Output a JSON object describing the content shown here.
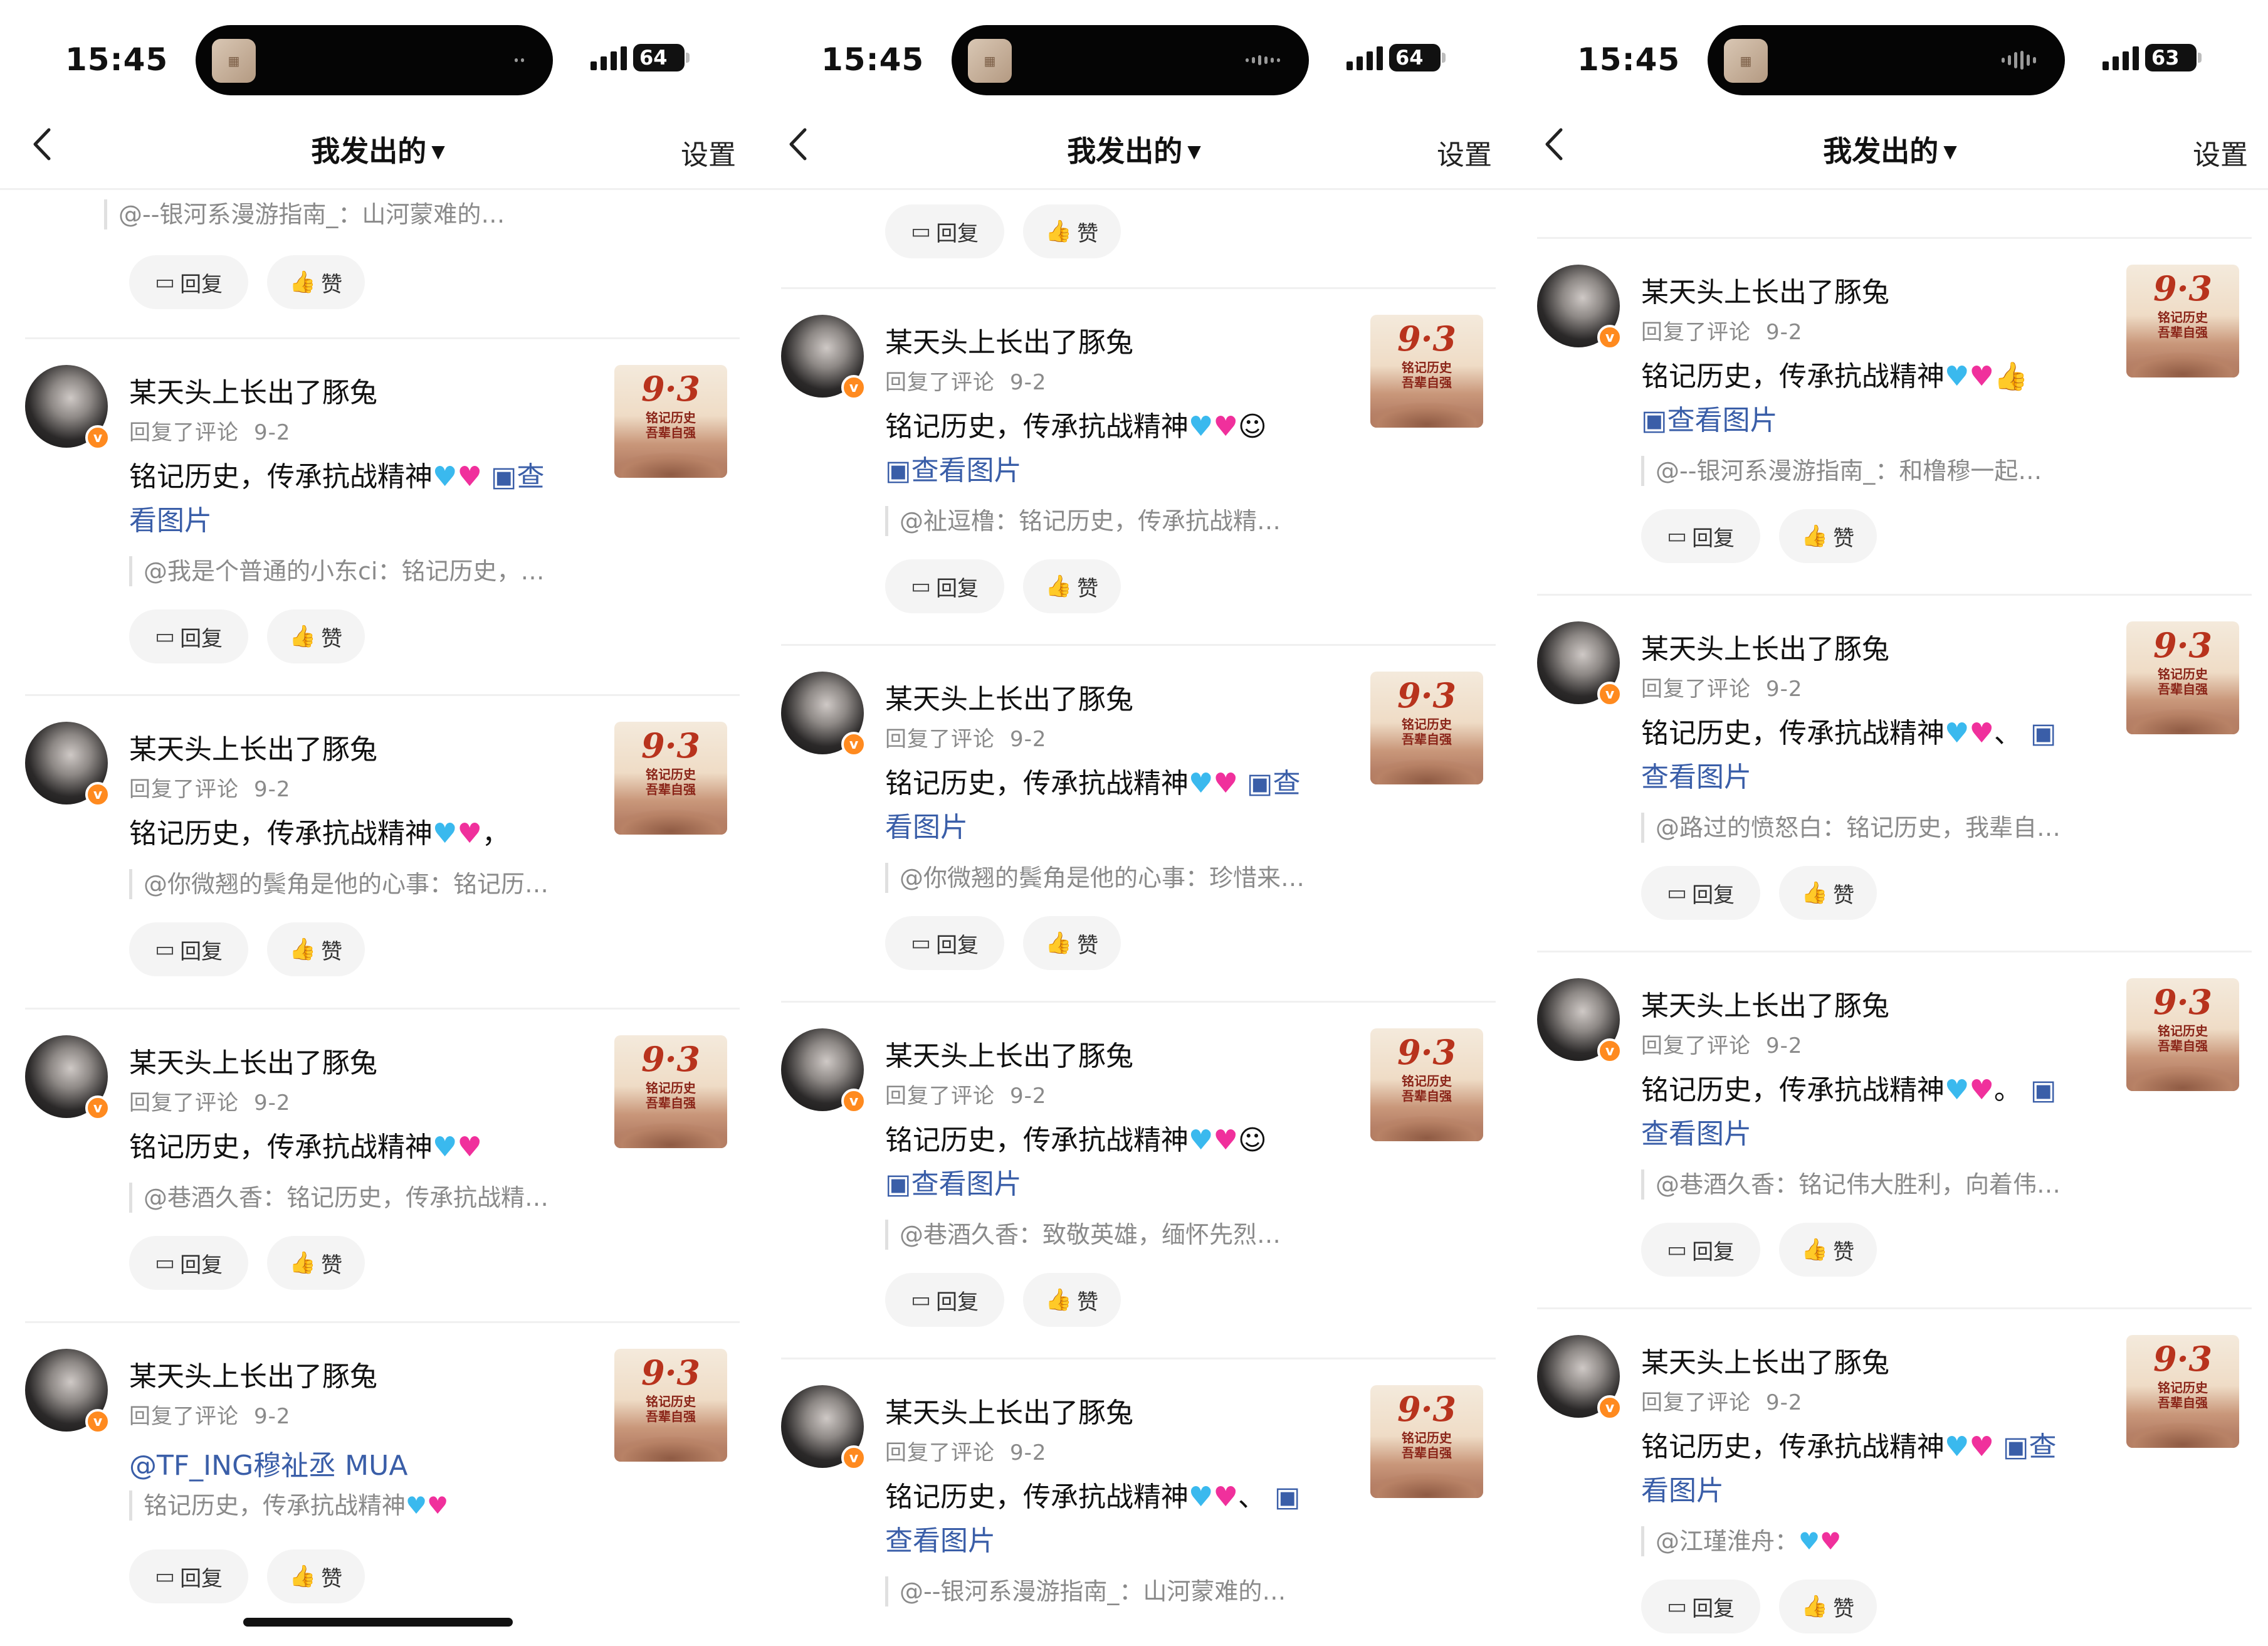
{
  "panels": [
    {
      "status": {
        "time": "15:45",
        "battery": "64"
      },
      "nav": {
        "title": "我发出的",
        "caret": "▼",
        "settings": "设置"
      },
      "top_partial": {
        "quote": "@--银河系漫游指南_：山河蒙难的…",
        "reply": "回复",
        "like": "赞"
      },
      "items": [
        {
          "user": "某天头上长出了豚兔",
          "action": "回复了评论",
          "date": "9-2",
          "text": "铭记历史，传承抗战精神",
          "tail": "查看图片",
          "quote": "@我是个普通的小东ci：铭记历史，…",
          "reply": "回复",
          "like": "赞"
        },
        {
          "user": "某天头上长出了豚兔",
          "action": "回复了评论",
          "date": "9-2",
          "text": "铭记历史，传承抗战精神",
          "tail": "，",
          "quote": "@你微翘的鬓角是他的心事：铭记历…",
          "reply": "回复",
          "like": "赞"
        },
        {
          "user": "某天头上长出了豚兔",
          "action": "回复了评论",
          "date": "9-2",
          "text": "铭记历史，传承抗战精神",
          "tail": "",
          "quote": "@巷酒久香：铭记历史，传承抗战精…",
          "reply": "回复",
          "like": "赞"
        },
        {
          "user": "某天头上长出了豚兔",
          "action": "回复了评论",
          "date": "9-2",
          "mention": "@TF_ING穆祉丞 MUA",
          "text": "铭记历史，传承抗战精神",
          "reply": "回复",
          "like": "赞"
        }
      ]
    },
    {
      "status": {
        "time": "15:45",
        "battery": "64"
      },
      "nav": {
        "title": "我发出的",
        "caret": "▼",
        "settings": "设置"
      },
      "top_partial": {
        "reply": "回复",
        "like": "赞"
      },
      "items": [
        {
          "user": "某天头上长出了豚兔",
          "action": "回复了评论",
          "date": "9-2",
          "text": "铭记历史，传承抗战精神",
          "tail": "查看图片",
          "quote": "@祉逗橹：铭记历史，传承抗战精…",
          "reply": "回复",
          "like": "赞"
        },
        {
          "user": "某天头上长出了豚兔",
          "action": "回复了评论",
          "date": "9-2",
          "text": "铭记历史，传承抗战精神",
          "tail": "查看图片",
          "quote": "@你微翘的鬓角是他的心事：珍惜来…",
          "reply": "回复",
          "like": "赞"
        },
        {
          "user": "某天头上长出了豚兔",
          "action": "回复了评论",
          "date": "9-2",
          "text": "铭记历史，传承抗战精神",
          "tail": "查看图片",
          "quote": "@巷酒久香：致敬英雄，缅怀先烈…",
          "reply": "回复",
          "like": "赞"
        },
        {
          "user": "某天头上长出了豚兔",
          "action": "回复了评论",
          "date": "9-2",
          "text": "铭记历史，传承抗战精神",
          "tail": "查看图片",
          "quote": "@--银河系漫游指南_：山河蒙难的…",
          "reply": "回复",
          "like": "赞"
        }
      ]
    },
    {
      "status": {
        "time": "15:45",
        "battery": "63"
      },
      "nav": {
        "title": "我发出的",
        "caret": "▼",
        "settings": "设置"
      },
      "items": [
        {
          "user": "某天头上长出了豚兔",
          "action": "回复了评论",
          "date": "9-2",
          "text": "铭记历史，传承抗战精神",
          "tail": "查看图片",
          "quote": "@--银河系漫游指南_：和橹穆一起…",
          "reply": "回复",
          "like": "赞"
        },
        {
          "user": "某天头上长出了豚兔",
          "action": "回复了评论",
          "date": "9-2",
          "text": "铭记历史，传承抗战精神",
          "tail": "查看图片",
          "quote": "@路过的愤怒白：铭记历史，我辈自…",
          "reply": "回复",
          "like": "赞"
        },
        {
          "user": "某天头上长出了豚兔",
          "action": "回复了评论",
          "date": "9-2",
          "text": "铭记历史，传承抗战精神",
          "tail": "查看图片",
          "quote": "@巷酒久香：铭记伟大胜利，向着伟…",
          "reply": "回复",
          "like": "赞"
        },
        {
          "user": "某天头上长出了豚兔",
          "action": "回复了评论",
          "date": "9-2",
          "text": "铭记历史，传承抗战精神",
          "tail": "查看图片",
          "quote": "@江瑾淮舟：",
          "reply": "回复",
          "like": "赞"
        }
      ]
    }
  ],
  "thumb": {
    "big": "9·3",
    "line1": "铭记历史",
    "line2": "吾辈自强"
  },
  "icons": {
    "back": "chevron-left-icon",
    "reply": "comment-icon",
    "like": "thumbs-up-icon",
    "image": "image-icon"
  },
  "colors": {
    "link": "#3a5ea8",
    "muted": "#8a8a8a",
    "badge": "#ff8a1f",
    "heart_blue": "#3ab9ee",
    "heart_pink": "#f0309c"
  }
}
